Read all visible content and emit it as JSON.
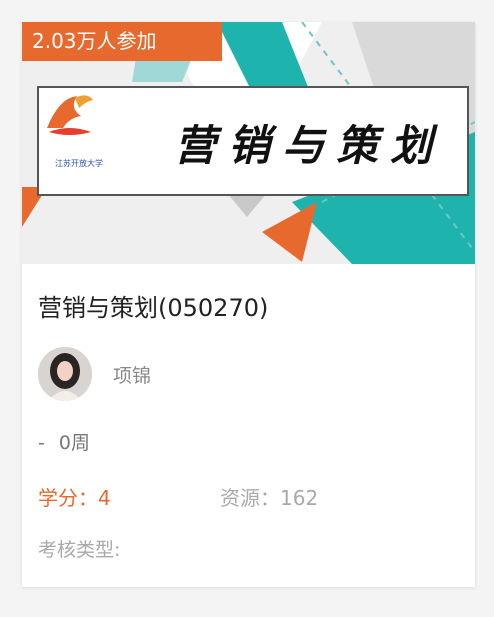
{
  "course_card": {
    "participants_badge": "2.03万人参加",
    "banner_title": "营销与策划",
    "logo_text": "江苏开放大学",
    "title": "营销与策划(050270)",
    "teacher": "项锦",
    "duration_dash": "-",
    "duration": "0周",
    "credit": "学分：4",
    "resources": "资源：162",
    "assessment_type": "考核类型:"
  },
  "colors": {
    "accent": "#e8692d",
    "teal": "#1fb3ad",
    "light_teal": "#9fd8d6"
  }
}
